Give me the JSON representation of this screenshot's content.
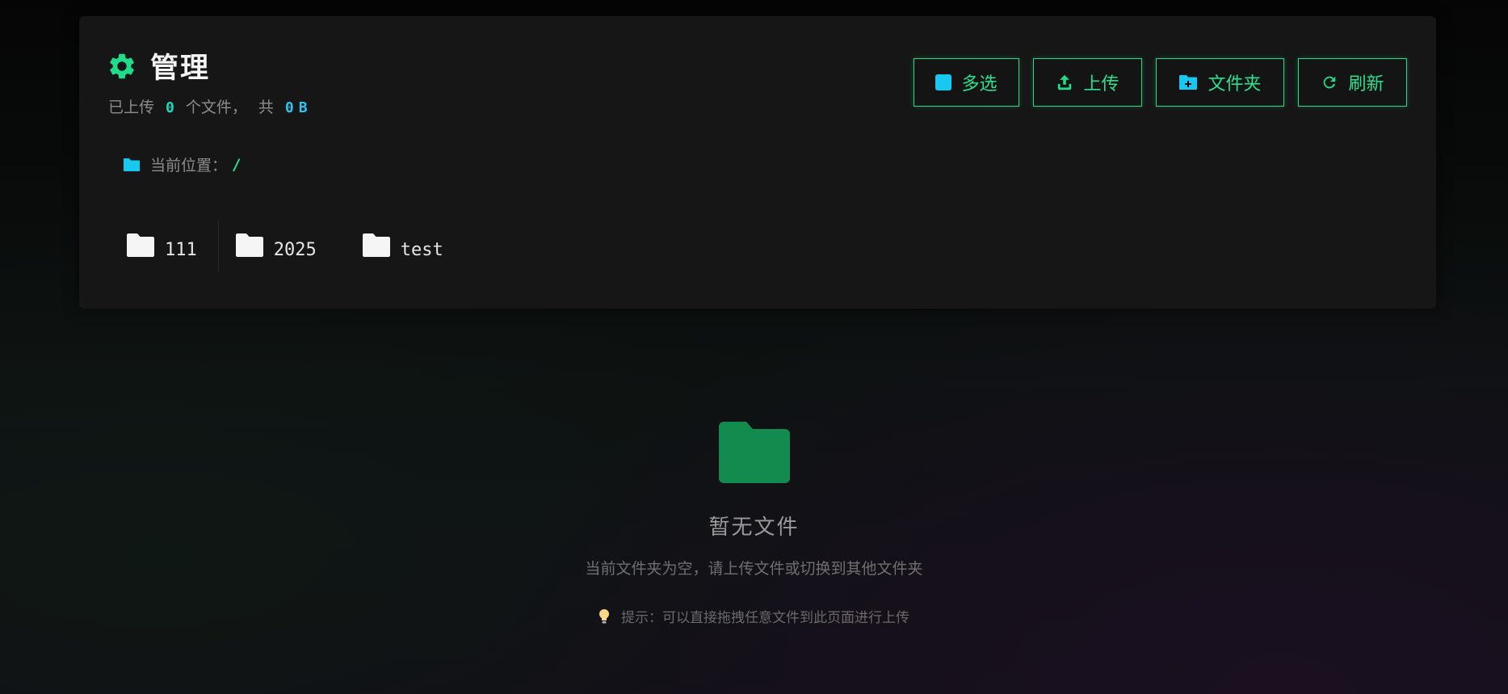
{
  "header": {
    "title": "管理",
    "stats": {
      "uploaded_prefix": "已上传",
      "file_count": "0",
      "files_suffix": "个文件，",
      "total_prefix": "共",
      "total_size": "0",
      "total_unit": "B"
    }
  },
  "toolbar": {
    "multi_select_label": "多选",
    "upload_label": "上传",
    "new_folder_label": "文件夹",
    "refresh_label": "刷新"
  },
  "location": {
    "label": "当前位置：",
    "path": "/"
  },
  "folders": [
    {
      "name": "111"
    },
    {
      "name": "2025"
    },
    {
      "name": "test"
    }
  ],
  "empty_state": {
    "title": "暂无文件",
    "description": "当前文件夹为空，请上传文件或切换到其他文件夹",
    "tip": "提示：可以直接拖拽任意文件到此页面进行上传"
  },
  "colors": {
    "accent_green": "#1fdc8a",
    "accent_cyan": "#18c8f0",
    "empty_folder": "#138a4e"
  },
  "icons": {
    "title": "gear-icon",
    "multi_select": "checkbox-square-icon",
    "upload": "upload-icon",
    "new_folder": "folder-plus-icon",
    "refresh": "refresh-icon",
    "location": "folder-icon",
    "folder_item": "folder-icon",
    "empty_state": "folder-icon",
    "tip": "lightbulb-icon"
  }
}
